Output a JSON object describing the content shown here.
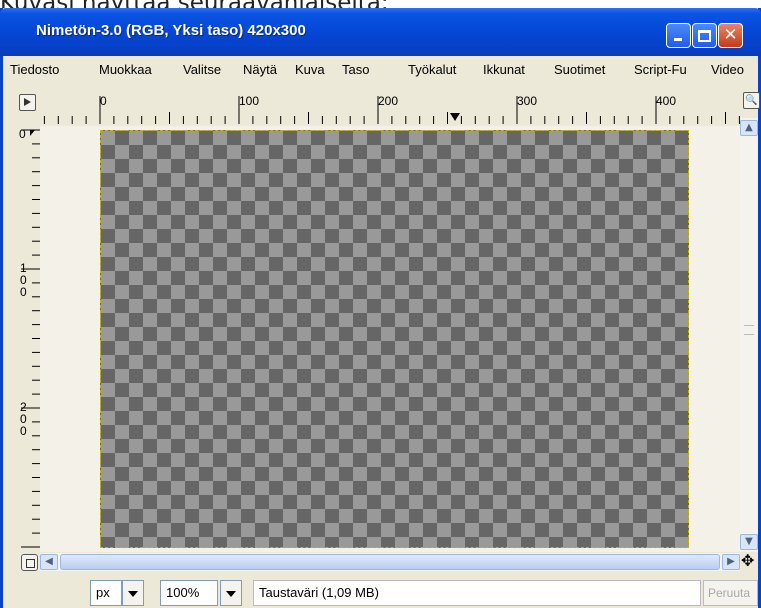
{
  "caption": "Kuvasi näyttää seuraavanlaiselta:",
  "window": {
    "title": "Nimetön-3.0 (RGB, Yksi taso) 420x300"
  },
  "menu": [
    "Tiedosto",
    "Muokkaa",
    "Valitse",
    "Näytä",
    "Kuva",
    "Taso",
    "Työkalut",
    "Ikkunat",
    "Suotimet",
    "Script-Fu",
    "Video"
  ],
  "ruler": {
    "h_labels": [
      "0",
      "100",
      "200",
      "300",
      "400"
    ],
    "v_labels": [
      "0",
      "1\n0\n0",
      "2\n0\n0"
    ]
  },
  "status": {
    "unit": "px",
    "zoom": "100%",
    "info": "Taustaväri (1,09 MB)",
    "undo_label": "Peruuta"
  },
  "colors": {
    "title_bar": "#0548d8",
    "canvas_bg": "#f4f2e8",
    "checker_dark": "#666666",
    "checker_light": "#999999",
    "selection_border": "#c9b400"
  }
}
